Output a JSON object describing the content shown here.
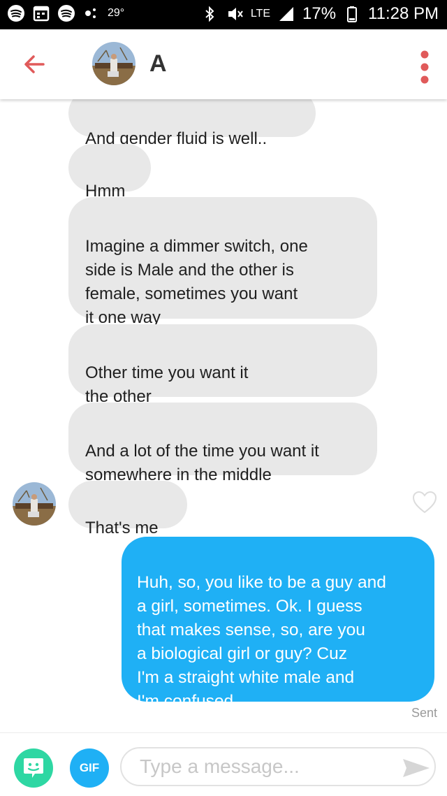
{
  "status_bar": {
    "temperature": "29°",
    "network": "LTE",
    "battery": "17%",
    "time": "11:28 PM",
    "icons": [
      "spotify-icon",
      "calendar-icon",
      "spotify-icon",
      "weather-icon",
      "bluetooth-icon",
      "mute-icon",
      "signal-icon",
      "battery-icon"
    ]
  },
  "header": {
    "back_icon": "back-arrow-icon",
    "contact_name": "A",
    "menu_icon": "more-vertical-icon"
  },
  "messages": [
    {
      "from": "them",
      "text": "And gender fluid is well.."
    },
    {
      "from": "them",
      "text": "Hmm"
    },
    {
      "from": "them",
      "text": "Imagine a dimmer switch, one\nside is Male and the other is\nfemale, sometimes you want\nit one way"
    },
    {
      "from": "them",
      "text": "Other time you want it\nthe other"
    },
    {
      "from": "them",
      "text": "And a lot of the time you want it\nsomewhere in the middle"
    },
    {
      "from": "them",
      "text": "That's me"
    },
    {
      "from": "me",
      "text": "Huh, so, you like to be a guy and\na girl, sometimes. Ok. I guess\nthat makes sense, so, are you\na biological girl or guy? Cuz\nI'm a straight white male and\nI'm confused."
    }
  ],
  "sent_status": "Sent",
  "input_bar": {
    "sticker_icon": "sticker-icon",
    "gif_label": "GIF",
    "placeholder": "Type a message...",
    "value": "",
    "send_icon": "send-icon"
  },
  "colors": {
    "accent_red": "#e05a5a",
    "my_bubble": "#1fb0f5",
    "their_bubble": "#e8e8e8",
    "sticker_green": "#2ed7a3"
  }
}
